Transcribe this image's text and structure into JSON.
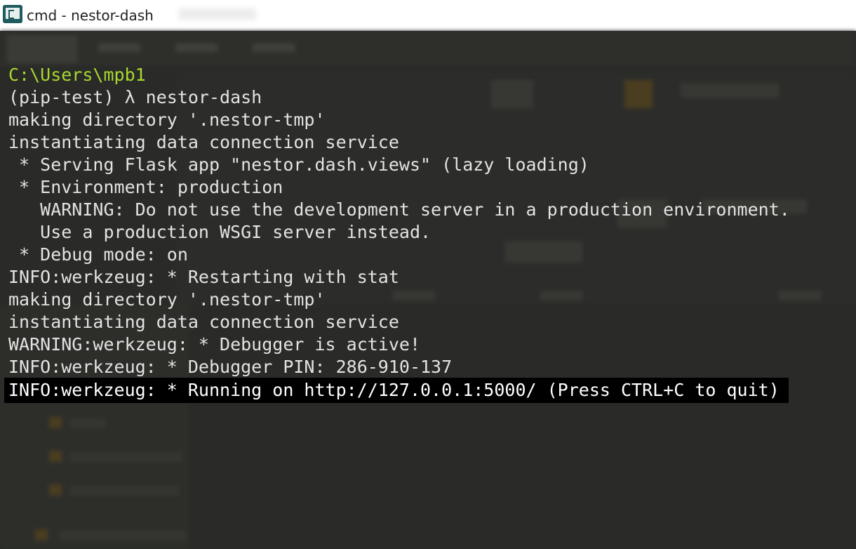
{
  "window": {
    "title": "cmd - nestor-dash"
  },
  "console": {
    "lines": [
      "C:\\Users\\mpb1",
      "(pip-test) λ nestor-dash",
      "making directory '.nestor-tmp'",
      "instantiating data connection service",
      " * Serving Flask app \"nestor.dash.views\" (lazy loading)",
      " * Environment: production",
      "   WARNING: Do not use the development server in a production environment.",
      "   Use a production WSGI server instead.",
      " * Debug mode: on",
      "INFO:werkzeug: * Restarting with stat",
      "making directory '.nestor-tmp'",
      "instantiating data connection service",
      "WARNING:werkzeug: * Debugger is active!",
      "INFO:werkzeug: * Debugger PIN: 286-910-137"
    ],
    "highlighted_line": "INFO:werkzeug: * Running on http://127.0.0.1:5000/ (Press CTRL+C to quit)"
  },
  "colors": {
    "background": "#2a2b28",
    "text": "#e3e3e3",
    "prompt_path": "#a8d830",
    "highlight_bg": "#000000",
    "highlight_text": "#ffffff"
  },
  "icons": {
    "app": "cmder-app-icon"
  }
}
